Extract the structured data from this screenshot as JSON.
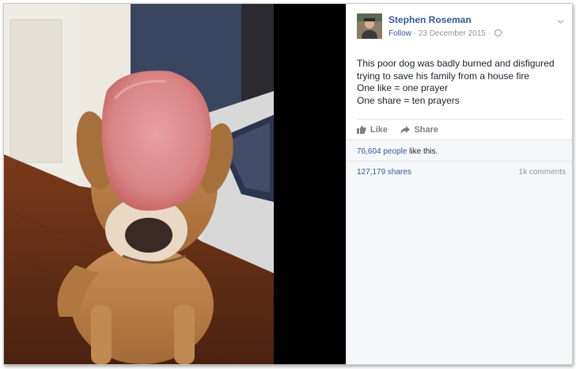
{
  "post": {
    "author": "Stephen Roseman",
    "follow_label": "Follow",
    "date": "23 December 2015",
    "separator": "·",
    "privacy_icon": "globe-icon",
    "menu_icon": "chevron-down-icon",
    "text_lines": [
      "This poor dog was badly burned and disfigured",
      "trying to save his family from a house fire",
      "One like = one prayer",
      "One share = ten prayers"
    ],
    "actions": {
      "like_label": "Like",
      "like_icon": "thumbs-up-icon",
      "share_label": "Share",
      "share_icon": "share-arrow-icon"
    },
    "likes": {
      "count": "76,604 people",
      "suffix": " like this."
    },
    "shares_label": "127,179 shares",
    "comments_label": "1k comments"
  },
  "colors": {
    "link_blue": "#365899",
    "meta_gray": "#90949c",
    "panel_bg": "#f6f7f9",
    "text": "#1d2129"
  }
}
